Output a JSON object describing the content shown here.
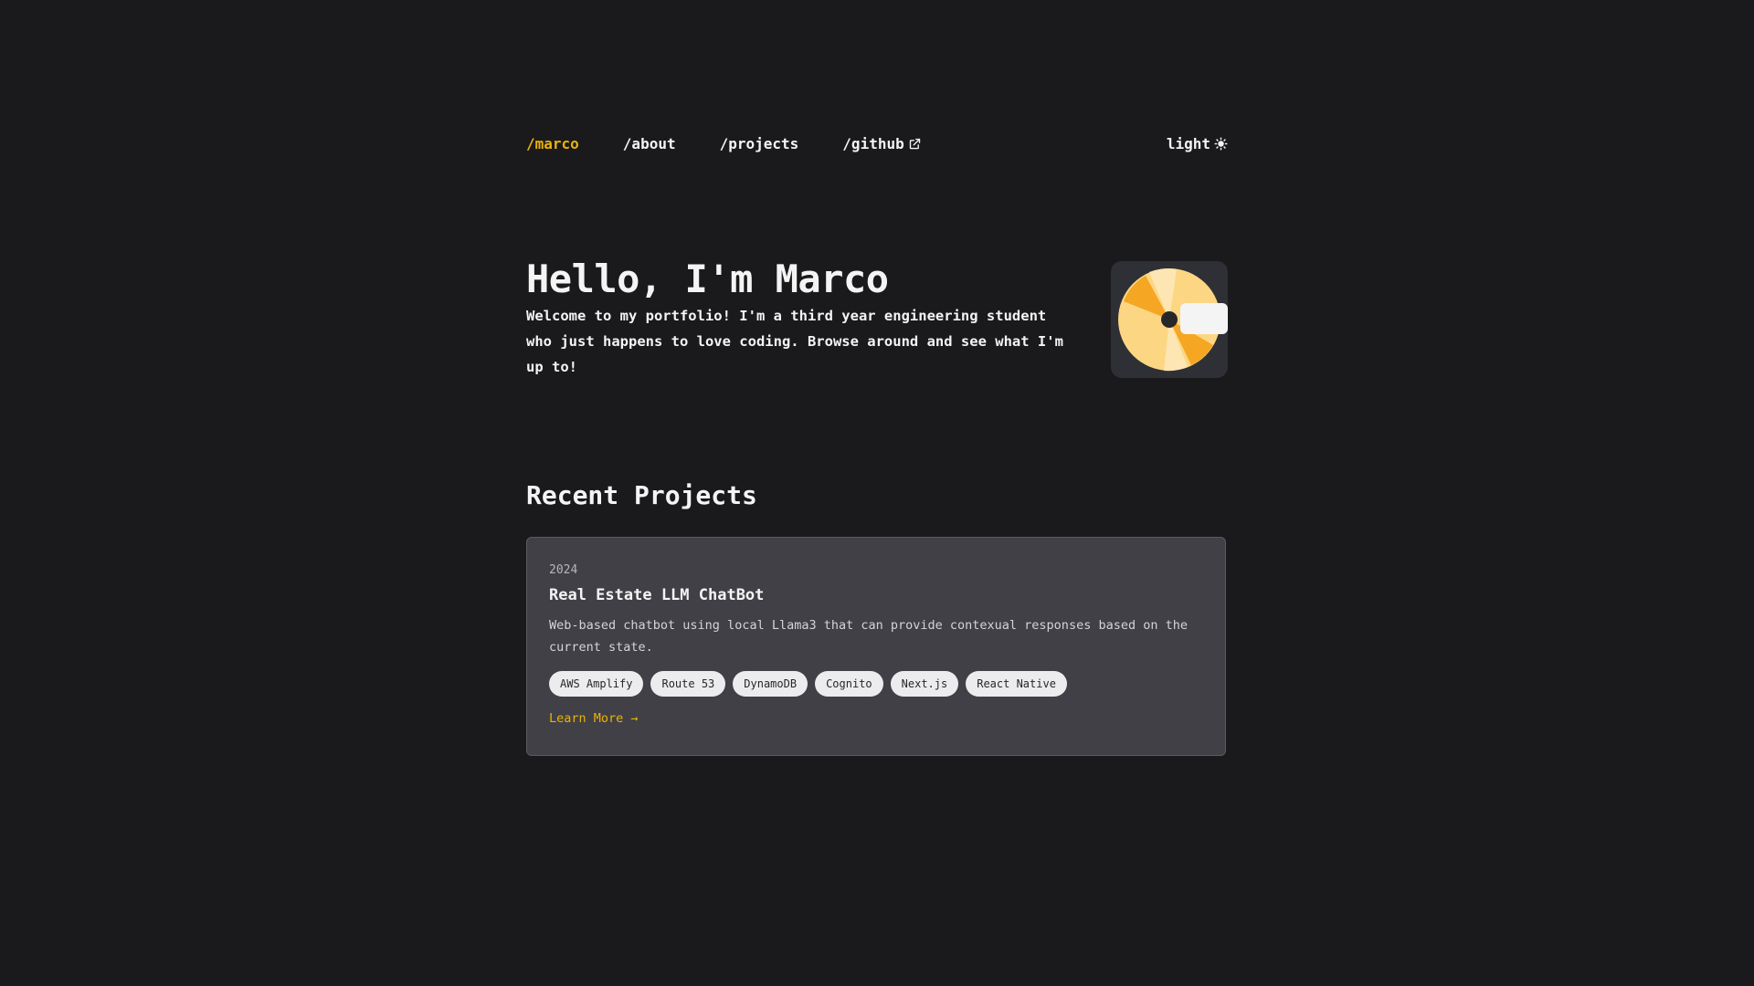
{
  "nav": {
    "home": "/marco",
    "about": "/about",
    "projects": "/projects",
    "github": "/github",
    "github_icon": "external-link-icon",
    "theme_label": "light",
    "theme_icon": "sun-icon"
  },
  "hero": {
    "title": "Hello, I'm Marco",
    "description": "Welcome to my portfolio! I'm a third year engineering student who just happens to love coding. Browse around and see what I'm up to!",
    "avatar_icon": "pixel-avatar-icon"
  },
  "recent": {
    "heading": "Recent Projects",
    "projects": [
      {
        "year": "2024",
        "title": "Real Estate LLM ChatBot",
        "description": "Web-based chatbot using local Llama3 that can provide contexual responses based on the current state.",
        "tags": [
          "AWS Amplify",
          "Route 53",
          "DynamoDB",
          "Cognito",
          "Next.js",
          "React Native"
        ],
        "link_label": "Learn More →"
      }
    ]
  },
  "colors": {
    "background": "#1a1a1c",
    "accent": "#eab308",
    "card": "#414046",
    "tag_bg": "#ececee"
  }
}
